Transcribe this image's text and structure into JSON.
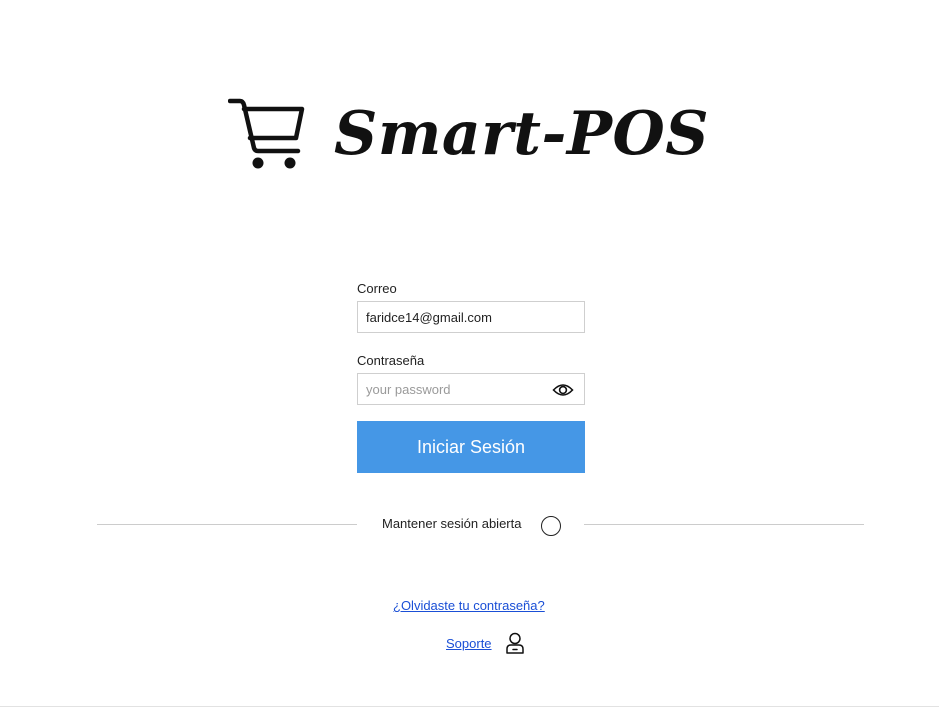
{
  "brand": {
    "title": "Smart-POS",
    "icon": "shopping-cart-icon"
  },
  "form": {
    "email_label": "Correo",
    "email_value": "faridce14@gmail.com",
    "password_label": "Contraseña",
    "password_placeholder": "your password",
    "password_toggle_icon": "eye-icon",
    "submit_label": "Iniciar Sesión"
  },
  "keep_session": {
    "label": "Mantener sesión abierta",
    "checked": false
  },
  "links": {
    "forgot_password": "¿Olvidaste tu contraseña?",
    "support": "Soporte",
    "support_icon": "user-support-icon"
  },
  "colors": {
    "primary_button": "#4597e6",
    "link": "#1a4fd6"
  }
}
